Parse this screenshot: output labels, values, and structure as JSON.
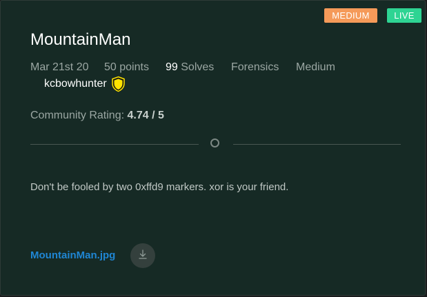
{
  "badges": {
    "difficulty": "MEDIUM",
    "status": "LIVE"
  },
  "challenge": {
    "title": "MountainMan",
    "date": "Mar 21st 20",
    "points": "50 points",
    "solves_count": "99",
    "solves_label": " Solves",
    "category": "Forensics",
    "difficulty": "Medium",
    "author": "kcbowhunter",
    "author_badge_icon": "shield-icon"
  },
  "rating": {
    "label": "Community Rating: ",
    "value": "4.74 / 5"
  },
  "description": "Don't be fooled by two 0xffd9 markers. xor is your friend.",
  "attachment": {
    "filename": "MountainMan.jpg",
    "download_icon": "download-icon"
  },
  "colors": {
    "difficulty_badge": "#f59a59",
    "status_badge": "#2ed493",
    "link": "#1f86d4",
    "card_background": "#162a25"
  }
}
